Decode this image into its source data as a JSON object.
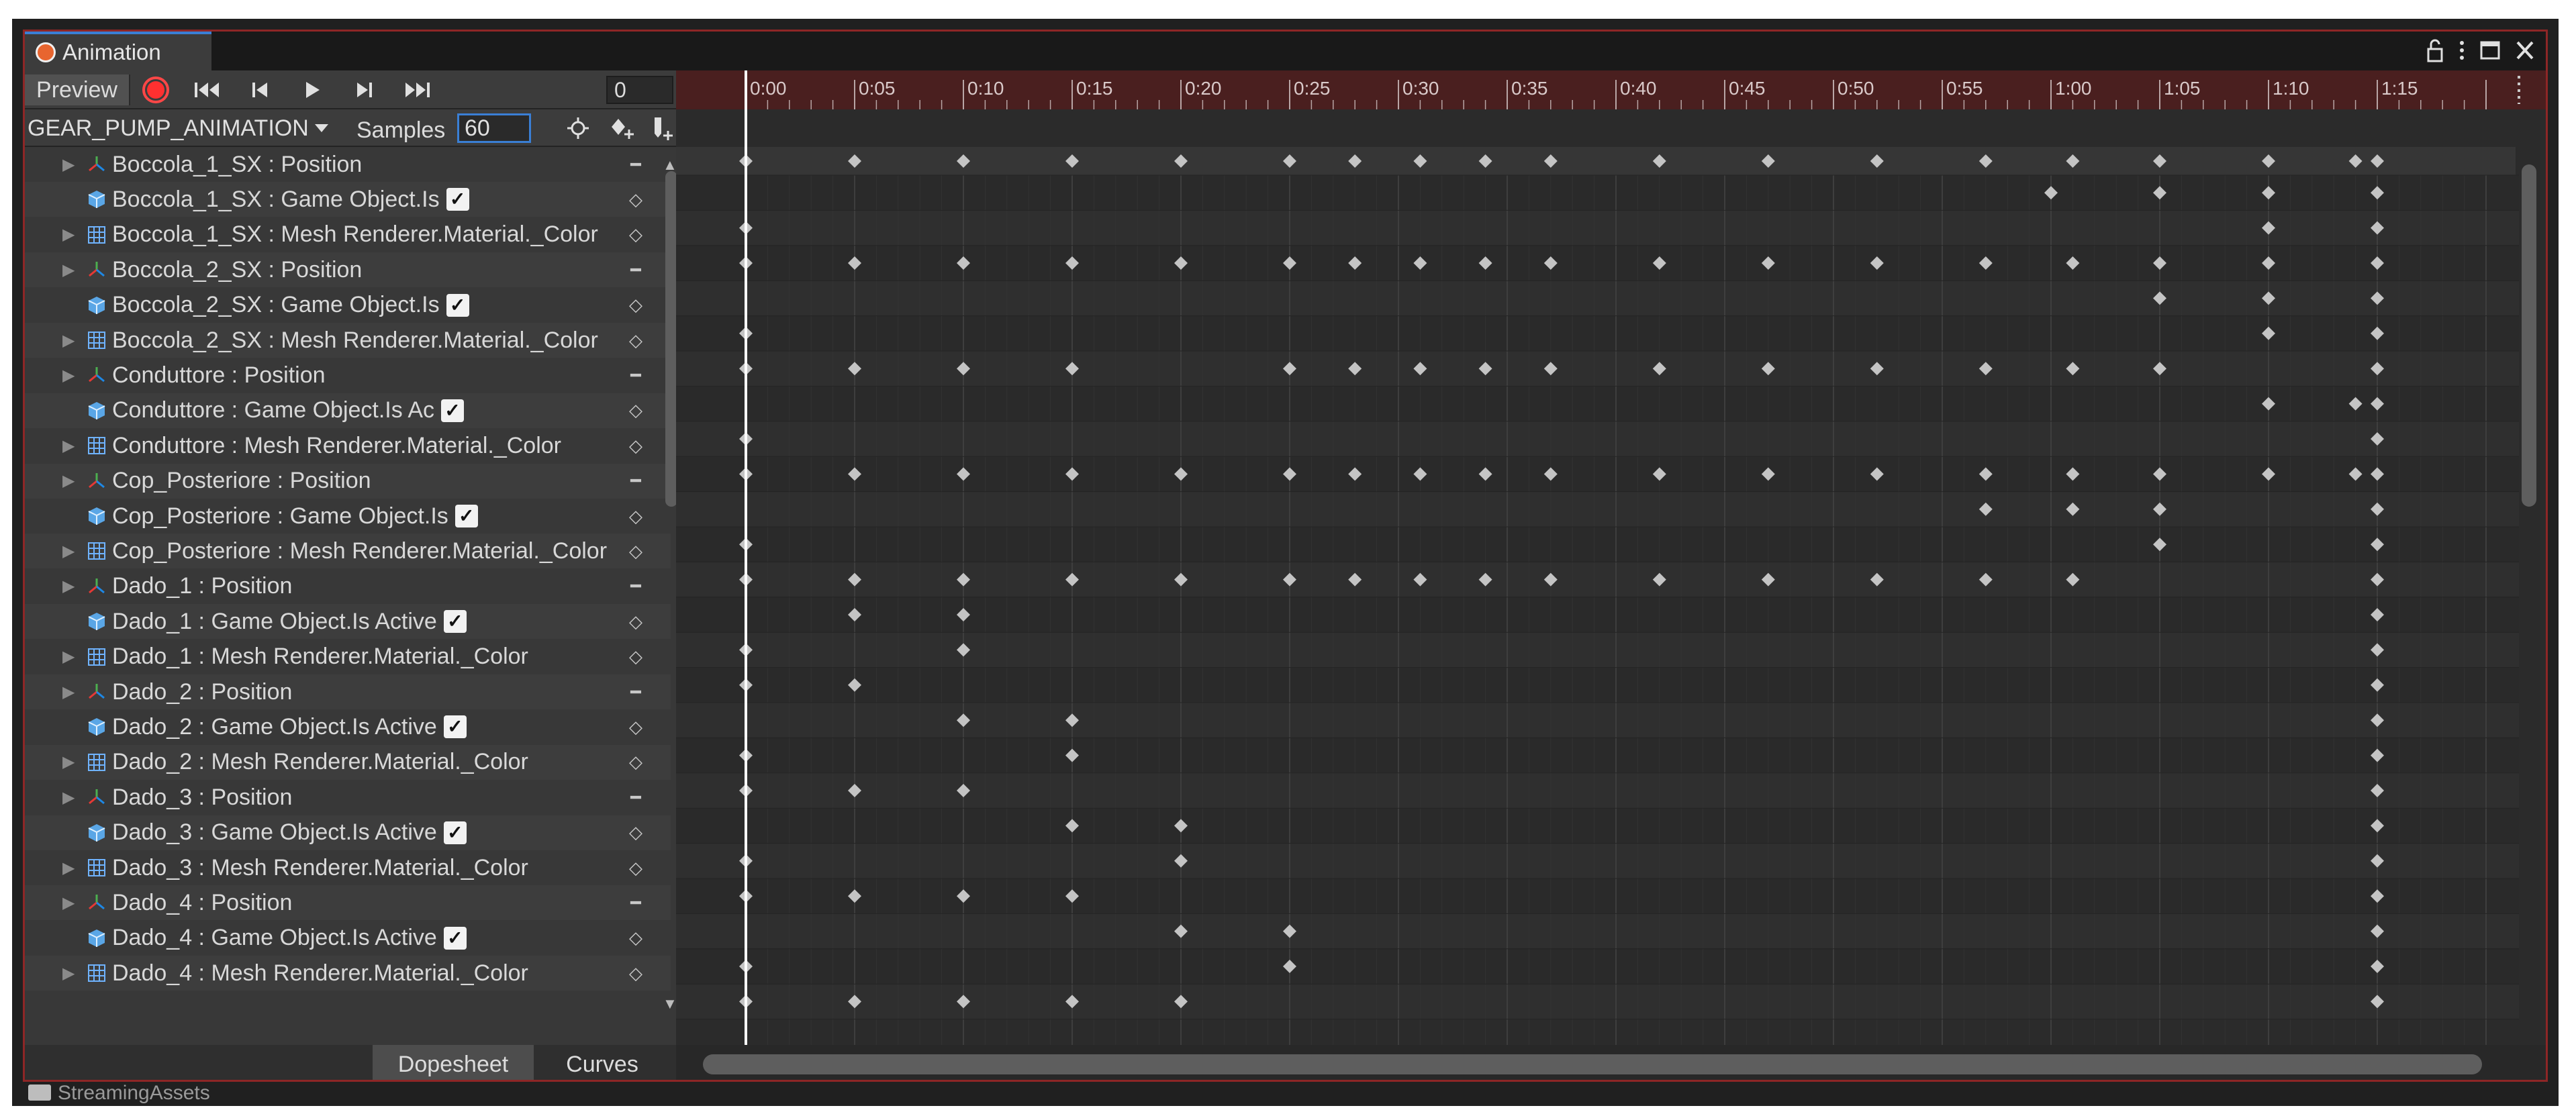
{
  "window": {
    "tab_label": "Animation",
    "controls": [
      "lock-icon",
      "more-icon",
      "maximize-icon",
      "close-icon"
    ]
  },
  "toolbar": {
    "preview_label": "Preview",
    "frame_value": "0",
    "clip_name": "GEAR_PUMP_ANIMATION",
    "samples_label": "Samples",
    "samples_value": "60"
  },
  "ruler": {
    "labels": [
      "0:00",
      "0:05",
      "0:10",
      "0:15",
      "0:20",
      "0:25",
      "0:30",
      "0:35",
      "0:40",
      "0:45",
      "0:50",
      "0:55",
      "1:00",
      "1:05",
      "1:10",
      "1:15"
    ]
  },
  "properties": [
    {
      "label": "Boccola_1_SX : Position",
      "kind": "position",
      "expand": true,
      "key": [
        60,
        65,
        70,
        75
      ]
    },
    {
      "label": "Boccola_1_SX : Game Object.Is",
      "kind": "gameobject",
      "expand": false,
      "check": true,
      "key": [
        0,
        70,
        75
      ]
    },
    {
      "label": "Boccola_1_SX : Mesh Renderer.Material._Color",
      "kind": "mesh",
      "expand": true,
      "key": [
        0,
        5,
        10,
        15,
        20,
        25,
        28,
        31,
        34,
        37,
        42,
        47,
        52,
        57,
        61,
        65,
        70,
        75
      ]
    },
    {
      "label": "Boccola_2_SX : Position",
      "kind": "position",
      "expand": true,
      "key": [
        65,
        70,
        75
      ]
    },
    {
      "label": "Boccola_2_SX : Game Object.Is",
      "kind": "gameobject",
      "expand": false,
      "check": true,
      "key": [
        0,
        70,
        75
      ]
    },
    {
      "label": "Boccola_2_SX : Mesh Renderer.Material._Color",
      "kind": "mesh",
      "expand": true,
      "key": [
        0,
        5,
        10,
        15,
        25,
        28,
        31,
        34,
        37,
        42,
        47,
        52,
        57,
        61,
        65,
        75
      ]
    },
    {
      "label": "Conduttore : Position",
      "kind": "position",
      "expand": true,
      "key": [
        70,
        74,
        75
      ]
    },
    {
      "label": "Conduttore : Game Object.Is Ac",
      "kind": "gameobject",
      "expand": false,
      "check": true,
      "key": [
        0,
        75
      ]
    },
    {
      "label": "Conduttore : Mesh Renderer.Material._Color",
      "kind": "mesh",
      "expand": true,
      "key": [
        0,
        5,
        10,
        15,
        20,
        25,
        28,
        31,
        34,
        37,
        42,
        47,
        52,
        57,
        61,
        65,
        70,
        74,
        75
      ]
    },
    {
      "label": "Cop_Posteriore : Position",
      "kind": "position",
      "expand": true,
      "key": [
        57,
        61,
        65,
        75
      ]
    },
    {
      "label": "Cop_Posteriore : Game Object.Is",
      "kind": "gameobject",
      "expand": false,
      "check": true,
      "key": [
        0,
        65,
        75
      ]
    },
    {
      "label": "Cop_Posteriore : Mesh Renderer.Material._Color",
      "kind": "mesh",
      "expand": true,
      "key": [
        0,
        5,
        10,
        15,
        20,
        25,
        28,
        31,
        34,
        37,
        42,
        47,
        52,
        57,
        61,
        75
      ]
    },
    {
      "label": "Dado_1 : Position",
      "kind": "position",
      "expand": true,
      "key": [
        5,
        10,
        75
      ]
    },
    {
      "label": "Dado_1 : Game Object.Is Active",
      "kind": "gameobject",
      "expand": false,
      "check": true,
      "key": [
        0,
        10,
        75
      ]
    },
    {
      "label": "Dado_1 : Mesh Renderer.Material._Color",
      "kind": "mesh",
      "expand": true,
      "key": [
        0,
        5,
        75
      ]
    },
    {
      "label": "Dado_2 : Position",
      "kind": "position",
      "expand": true,
      "key": [
        10,
        15,
        75
      ]
    },
    {
      "label": "Dado_2 : Game Object.Is Active",
      "kind": "gameobject",
      "expand": false,
      "check": true,
      "key": [
        0,
        15,
        75
      ]
    },
    {
      "label": "Dado_2 : Mesh Renderer.Material._Color",
      "kind": "mesh",
      "expand": true,
      "key": [
        0,
        5,
        10,
        75
      ]
    },
    {
      "label": "Dado_3 : Position",
      "kind": "position",
      "expand": true,
      "key": [
        15,
        20,
        75
      ]
    },
    {
      "label": "Dado_3 : Game Object.Is Active",
      "kind": "gameobject",
      "expand": false,
      "check": true,
      "key": [
        0,
        20,
        75
      ]
    },
    {
      "label": "Dado_3 : Mesh Renderer.Material._Color",
      "kind": "mesh",
      "expand": true,
      "key": [
        0,
        5,
        10,
        15,
        75
      ]
    },
    {
      "label": "Dado_4 : Position",
      "kind": "position",
      "expand": true,
      "key": [
        20,
        25,
        75
      ]
    },
    {
      "label": "Dado_4 : Game Object.Is Active",
      "kind": "gameobject",
      "expand": false,
      "check": true,
      "key": [
        0,
        25,
        75
      ]
    },
    {
      "label": "Dado_4 : Mesh Renderer.Material._Color",
      "kind": "mesh",
      "expand": true,
      "key": [
        0,
        5,
        10,
        15,
        20,
        75
      ]
    }
  ],
  "summary_keys": [
    0,
    5,
    10,
    15,
    20,
    25,
    28,
    31,
    34,
    37,
    42,
    47,
    52,
    57,
    61,
    65,
    70,
    74,
    75
  ],
  "bottom_tabs": {
    "dopesheet": "Dopesheet",
    "curves": "Curves"
  },
  "below": {
    "folder_label": "StreamingAssets"
  },
  "colors": {
    "record": "#ff3030",
    "accent": "#3a7fd5",
    "ruler_bg": "#4a1f1f",
    "key": "#c4c4c4",
    "playhead": "#ffffff"
  }
}
